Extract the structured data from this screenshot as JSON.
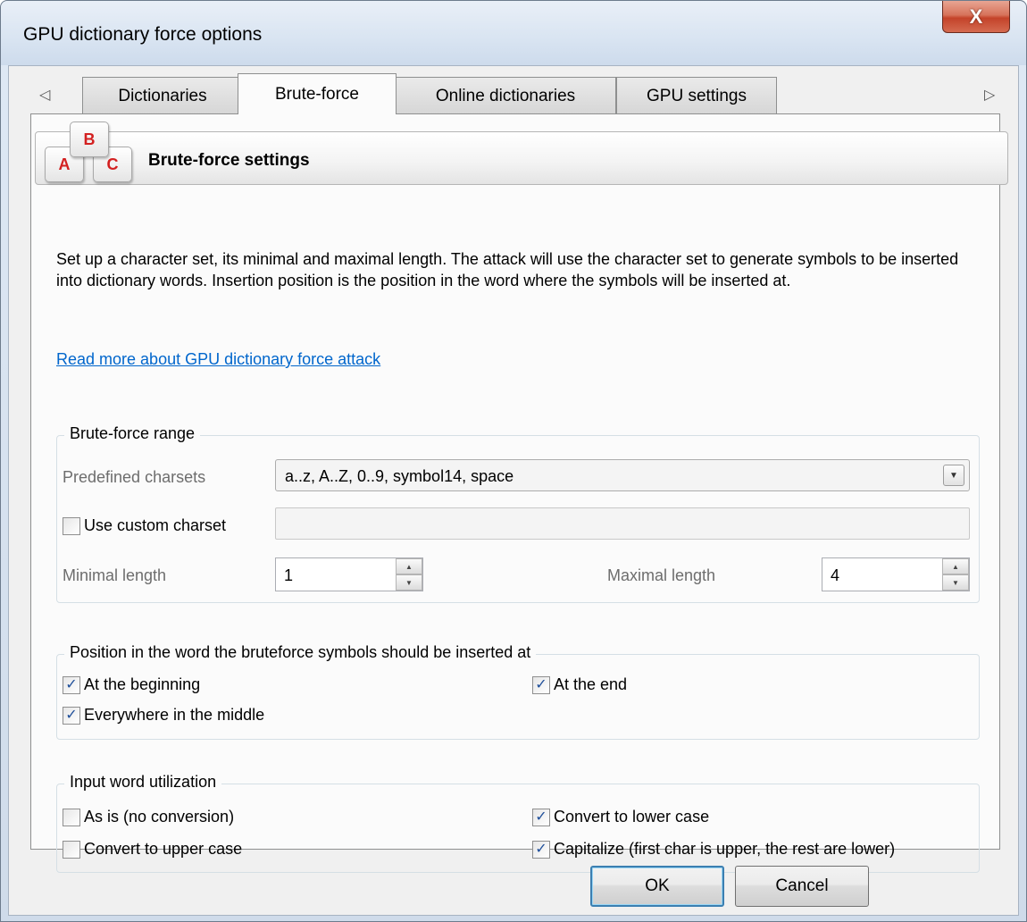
{
  "window": {
    "title": "GPU dictionary force options",
    "close_label": "X"
  },
  "tabs": {
    "scroll_left": "◁",
    "scroll_right": "▷",
    "items": [
      {
        "label": "Dictionaries"
      },
      {
        "label": "Brute-force"
      },
      {
        "label": "Online dictionaries"
      },
      {
        "label": "GPU settings"
      }
    ],
    "active": "Brute-force"
  },
  "header": {
    "title": "Brute-force settings",
    "icon_keys": [
      "A",
      "B",
      "C"
    ]
  },
  "description": "Set up a character set, its minimal and maximal length. The attack will use the character set to generate symbols to be inserted into dictionary words. Insertion position is the position in the word where the symbols will be inserted at.",
  "link": "Read more about GPU dictionary force attack",
  "brute_force_range": {
    "title": "Brute-force range",
    "predefined_label": "Predefined charsets",
    "predefined_value": "a..z, A..Z, 0..9, symbol14, space",
    "custom_label": "Use custom charset",
    "custom_checked": false,
    "custom_value": "",
    "min_label": "Minimal length",
    "min_value": "1",
    "max_label": "Maximal length",
    "max_value": "4"
  },
  "position": {
    "title": "Position in the word the bruteforce symbols should be inserted at",
    "beginning": {
      "label": "At the beginning",
      "checked": true
    },
    "end": {
      "label": "At the end",
      "checked": true
    },
    "middle": {
      "label": "Everywhere in the middle",
      "checked": true
    }
  },
  "input_word": {
    "title": "Input word utilization",
    "as_is": {
      "label": "As is (no conversion)",
      "checked": false
    },
    "lower": {
      "label": "Convert to lower case",
      "checked": true
    },
    "upper": {
      "label": "Convert to upper case",
      "checked": false
    },
    "capitalize": {
      "label": "Capitalize (first char is upper, the rest are lower)",
      "checked": true
    }
  },
  "buttons": {
    "ok": "OK",
    "cancel": "Cancel"
  },
  "glyphs": {
    "check": "✓",
    "combo_arrow": "▼",
    "spin_up": "▲",
    "spin_down": "▼"
  }
}
